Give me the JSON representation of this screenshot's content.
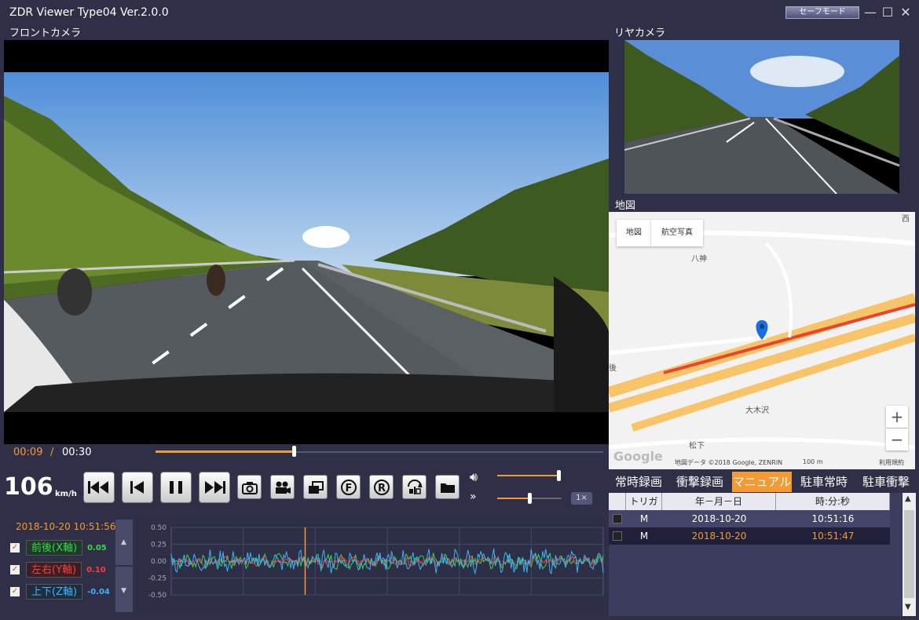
{
  "app": {
    "title": "ZDR Viewer Type04 Ver.2.0.0",
    "safe_mode_label": "セーフモード"
  },
  "labels": {
    "front_camera": "フロントカメラ",
    "rear_camera": "リヤカメラ",
    "map": "地図"
  },
  "playback": {
    "current_time": "00:09",
    "separator": "/",
    "total_time": "00:30",
    "progress": 0.31
  },
  "speed": {
    "value": "106",
    "unit": "km/h"
  },
  "controls": {
    "playback_rate": "1×",
    "volume": 0.95,
    "rate_slider": 0.5
  },
  "gsensor": {
    "datetime": "2018-10-20 10:51:56",
    "axes": [
      {
        "name": "前後(X軸)",
        "value": "0.05",
        "color": "#34d84a",
        "checked": "✓"
      },
      {
        "name": "左右(Y軸)",
        "value": "0.10",
        "color": "#ff3b3b",
        "checked": "✓"
      },
      {
        "name": "上下(Z軸)",
        "value": "-0.04",
        "color": "#37b6ff",
        "checked": "✓"
      }
    ]
  },
  "chart_data": {
    "type": "line",
    "title": "",
    "xlabel": "",
    "ylabel": "",
    "ylim": [
      -0.5,
      0.5
    ],
    "yticks": [
      "0.50",
      "0.25",
      "0.00",
      "-0.25",
      "-0.50"
    ],
    "series": [
      {
        "name": "前後(X軸)",
        "color": "#34d84a",
        "amplitude": 0.08
      },
      {
        "name": "左右(Y軸)",
        "color": "#ff3b3b",
        "amplitude": 0.05
      },
      {
        "name": "上下(Z軸)",
        "color": "#37b6ff",
        "amplitude": 0.12
      }
    ],
    "cursor_position": 0.31
  },
  "map": {
    "btn_map": "地図",
    "btn_aerial": "航空写真",
    "places": [
      "八神",
      "大木沢",
      "松下",
      "後",
      "西"
    ],
    "zoom_in": "+",
    "zoom_out": "−",
    "google_logo": "Google",
    "attribution": "地図データ ©2018 Google, ZENRIN",
    "scale": "100 m",
    "terms": "利用規約"
  },
  "tabs": [
    {
      "label": "常時録画",
      "active": false
    },
    {
      "label": "衝撃録画",
      "active": false
    },
    {
      "label": "マニュアル",
      "active": true
    },
    {
      "label": "駐車常時",
      "active": false
    },
    {
      "label": "駐車衝撃",
      "active": false
    }
  ],
  "table": {
    "headers": [
      "",
      "トリガ",
      "年－月－日",
      "時:分:秒"
    ],
    "rows": [
      {
        "trigger": "M",
        "date": "2018-10-20",
        "time": "10:51:16",
        "selected": false
      },
      {
        "trigger": "M",
        "date": "2018-10-20",
        "time": "10:51:47",
        "selected": true
      }
    ]
  },
  "colors": {
    "accent": "#f39a32",
    "background": "#2f2f48"
  }
}
